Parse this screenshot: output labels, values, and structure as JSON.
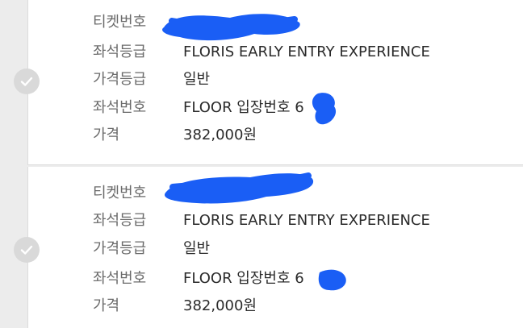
{
  "tickets": [
    {
      "rows": [
        {
          "label": "티켓번호",
          "value": ""
        },
        {
          "label": "좌석등급",
          "value": "FLORIS EARLY ENTRY EXPERIENCE"
        },
        {
          "label": "가격등급",
          "value": "일반"
        },
        {
          "label": "좌석번호",
          "value": "FLOOR 입장번호 6"
        },
        {
          "label": "가격",
          "value": "382,000원"
        }
      ]
    },
    {
      "rows": [
        {
          "label": "티켓번호",
          "value": ""
        },
        {
          "label": "좌석등급",
          "value": "FLORIS EARLY ENTRY EXPERIENCE"
        },
        {
          "label": "가격등급",
          "value": "일반"
        },
        {
          "label": "좌석번호",
          "value": "FLOOR 입장번호 6"
        },
        {
          "label": "가격",
          "value": "382,000원"
        }
      ]
    }
  ],
  "colors": {
    "redaction": "#1a5ef5",
    "check_bg": "#d9d9d9"
  },
  "icons": {
    "check": "check-icon"
  }
}
